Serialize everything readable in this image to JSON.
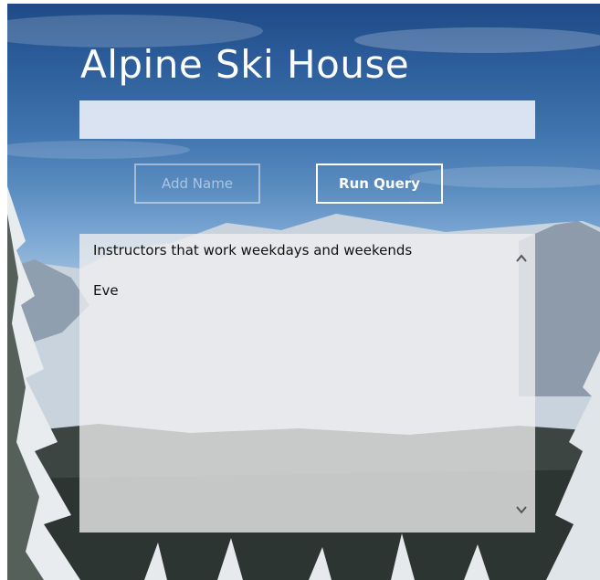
{
  "app": {
    "title": "Alpine Ski House"
  },
  "form": {
    "name_value": "",
    "name_placeholder": ""
  },
  "buttons": {
    "add_name_label": "Add Name",
    "run_query_label": "Run Query"
  },
  "results": {
    "heading": "Instructors that work weekdays and weekends",
    "items": [
      "Eve"
    ]
  },
  "icons": {
    "scroll_up": "chevron-up-icon",
    "scroll_down": "chevron-down-icon"
  },
  "colors": {
    "sky_top": "#1f4a86",
    "button_border": "#ffffff",
    "results_bg": "#f0f0f0"
  }
}
